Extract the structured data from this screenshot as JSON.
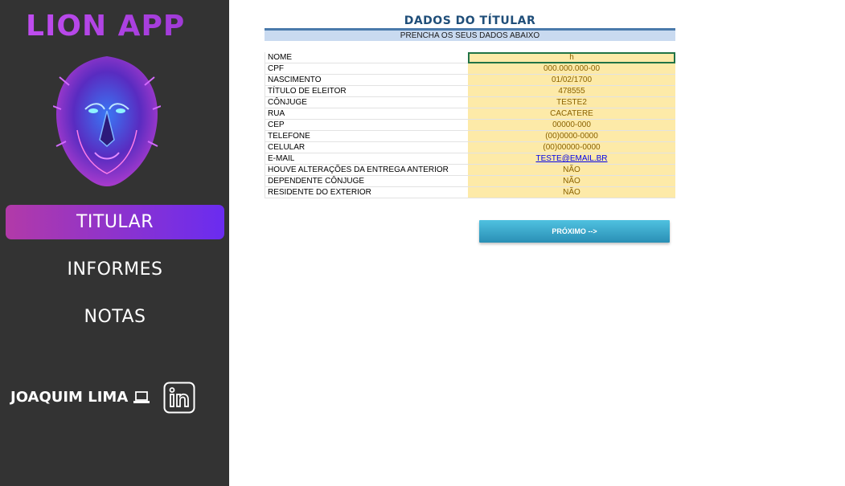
{
  "sidebar": {
    "logo": "LION APP",
    "nav": [
      {
        "label": "TITULAR",
        "active": true
      },
      {
        "label": "INFORMES",
        "active": false
      },
      {
        "label": "NOTAS",
        "active": false
      }
    ],
    "author": "JOAQUIM LIMA",
    "icons": [
      "lion-logo-icon",
      "laptop-icon",
      "linkedin-icon"
    ]
  },
  "form": {
    "title": "DADOS DO TÍTULAR",
    "subtitle": "PRENCHA OS SEUS DADOS ABAIXO",
    "rows": [
      {
        "label": "NOME",
        "value": "h"
      },
      {
        "label": "CPF",
        "value": "000.000.000-00"
      },
      {
        "label": "NASCIMENTO",
        "value": "01/02/1700"
      },
      {
        "label": "TÍTULO DE ELEITOR",
        "value": "478555"
      },
      {
        "label": "CÔNJUGE",
        "value": "TESTE2"
      },
      {
        "label": "RUA",
        "value": "CACATERE"
      },
      {
        "label": "CEP",
        "value": "00000-000"
      },
      {
        "label": "TELEFONE",
        "value": "(00)0000-0000"
      },
      {
        "label": "CELULAR",
        "value": "(00)00000-0000"
      },
      {
        "label": "E-MAIL",
        "value": "TESTE@EMAIL.BR"
      },
      {
        "label": "HOUVE ALTERAÇÕES DA ENTREGA ANTERIOR",
        "value": "NÃO"
      },
      {
        "label": "DEPENDENTE CÔNJUGE",
        "value": "NÃO"
      },
      {
        "label": "RESIDENTE DO EXTERIOR",
        "value": "NÃO"
      }
    ],
    "next_label": "PRÓXIMO -->"
  },
  "colors": {
    "sidebar_bg": "#333333",
    "active_gradient_start": "#b23aa8",
    "active_gradient_end": "#6a2cf0",
    "title_blue": "#1f4e79",
    "input_fill": "#fdeaa8",
    "button_blue": "#3aa7cc"
  }
}
